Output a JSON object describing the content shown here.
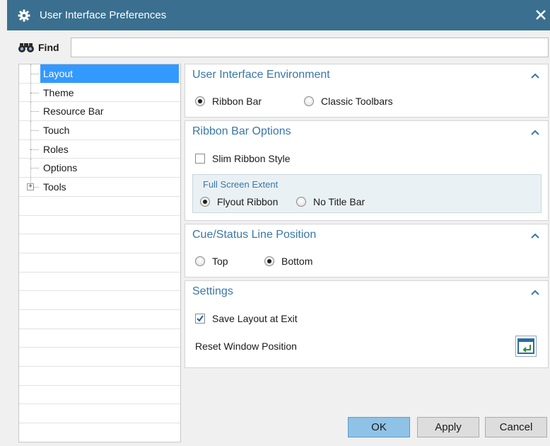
{
  "window": {
    "title": "User Interface Preferences"
  },
  "find": {
    "label": "Find",
    "value": ""
  },
  "tree": {
    "items": [
      {
        "label": "Layout",
        "selected": true,
        "expandable": false
      },
      {
        "label": "Theme",
        "selected": false,
        "expandable": false
      },
      {
        "label": "Resource Bar",
        "selected": false,
        "expandable": false
      },
      {
        "label": "Touch",
        "selected": false,
        "expandable": false
      },
      {
        "label": "Roles",
        "selected": false,
        "expandable": false
      },
      {
        "label": "Options",
        "selected": false,
        "expandable": false
      },
      {
        "label": "Tools",
        "selected": false,
        "expandable": true
      }
    ]
  },
  "sections": {
    "ui_env": {
      "title": "User Interface Environment",
      "options": [
        {
          "label": "Ribbon Bar",
          "selected": true
        },
        {
          "label": "Classic Toolbars",
          "selected": false
        }
      ]
    },
    "ribbon": {
      "title": "Ribbon Bar Options",
      "slim_label": "Slim Ribbon Style",
      "slim_checked": false,
      "fullscreen": {
        "title": "Full Screen Extent",
        "options": [
          {
            "label": "Flyout Ribbon",
            "selected": true
          },
          {
            "label": "No Title Bar",
            "selected": false
          }
        ]
      }
    },
    "cue": {
      "title": "Cue/Status Line Position",
      "options": [
        {
          "label": "Top",
          "selected": false
        },
        {
          "label": "Bottom",
          "selected": true
        }
      ]
    },
    "settings": {
      "title": "Settings",
      "save_label": "Save Layout at Exit",
      "save_checked": true,
      "reset_label": "Reset Window Position"
    }
  },
  "buttons": {
    "ok": "OK",
    "apply": "Apply",
    "cancel": "Cancel"
  },
  "colors": {
    "titlebar": "#3a6f8f",
    "accent": "#3877a8",
    "selection": "#3399ff",
    "primary_button": "#8ec2e6"
  }
}
